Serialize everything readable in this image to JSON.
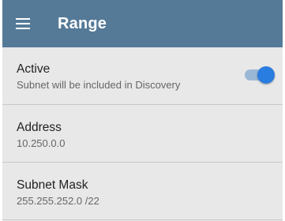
{
  "app_bar": {
    "title": "Range",
    "background": "#557a98",
    "menu_icon": "hamburger-menu-icon"
  },
  "settings": {
    "active": {
      "label": "Active",
      "description": "Subnet will be included in Discovery",
      "toggle_on": true,
      "accent": "#2a7de0"
    },
    "address": {
      "label": "Address",
      "value": "10.250.0.0"
    },
    "subnet_mask": {
      "label": "Subnet Mask",
      "value": "255.255.252.0 /22"
    }
  }
}
